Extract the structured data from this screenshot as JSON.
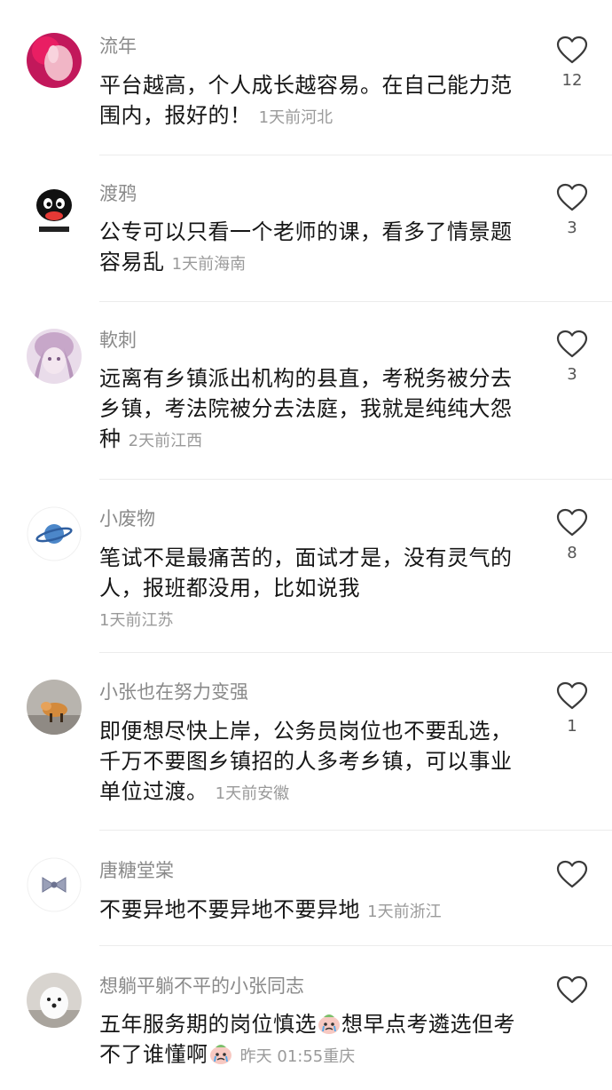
{
  "comments": [
    {
      "user": "流年",
      "text": "平台越高，个人成长越容易。在自己能力范围内，报好的！",
      "time": "1天前",
      "location": "河北",
      "likes": "12",
      "avatar": "pink-hand-photo"
    },
    {
      "user": "渡鸦",
      "text": "公专可以只看一个老师的课，看多了情景题容易乱",
      "time": "1天前",
      "location": "海南",
      "likes": "3",
      "avatar": "penguin-cartoon"
    },
    {
      "user": "軟刺",
      "text": "远离有乡镇派出机构的县直，考税务被分去乡镇，考法院被分去法庭，我就是纯纯大怨种",
      "time": "2天前",
      "location": "江西",
      "likes": "3",
      "avatar": "anime-girl"
    },
    {
      "user": "小废物",
      "text": "笔试不是最痛苦的，面试才是，没有灵气的人，报班都没用，比如说我",
      "time": "1天前",
      "location": "江苏",
      "likes": "8",
      "avatar": "planet-icon"
    },
    {
      "user": "小张也在努力变强",
      "text": "即便想尽快上岸，公务员岗位也不要乱选，千万不要图乡镇招的人多考乡镇，可以事业单位过渡。",
      "time": "1天前",
      "location": "安徽",
      "likes": "1",
      "avatar": "dog-photo"
    },
    {
      "user": "唐糖堂棠",
      "text": "不要异地不要异地不要异地",
      "time": "1天前",
      "location": "浙江",
      "likes": "",
      "avatar": "bow-icon"
    },
    {
      "user": "想躺平躺不平的小张同志",
      "text_a": "五年服务期的岗位慎选",
      "text_b": "想早点考遴选但考不了谁懂啊",
      "time": "昨天 01:55",
      "location": "重庆",
      "likes": "",
      "avatar": "white-dog-photo",
      "emoji": "crying-face-emoji"
    }
  ],
  "colors": {
    "username": "#8a8a8a",
    "text": "#161616",
    "meta": "#9a9a9a",
    "heart_outline": "#3a3a3a"
  }
}
